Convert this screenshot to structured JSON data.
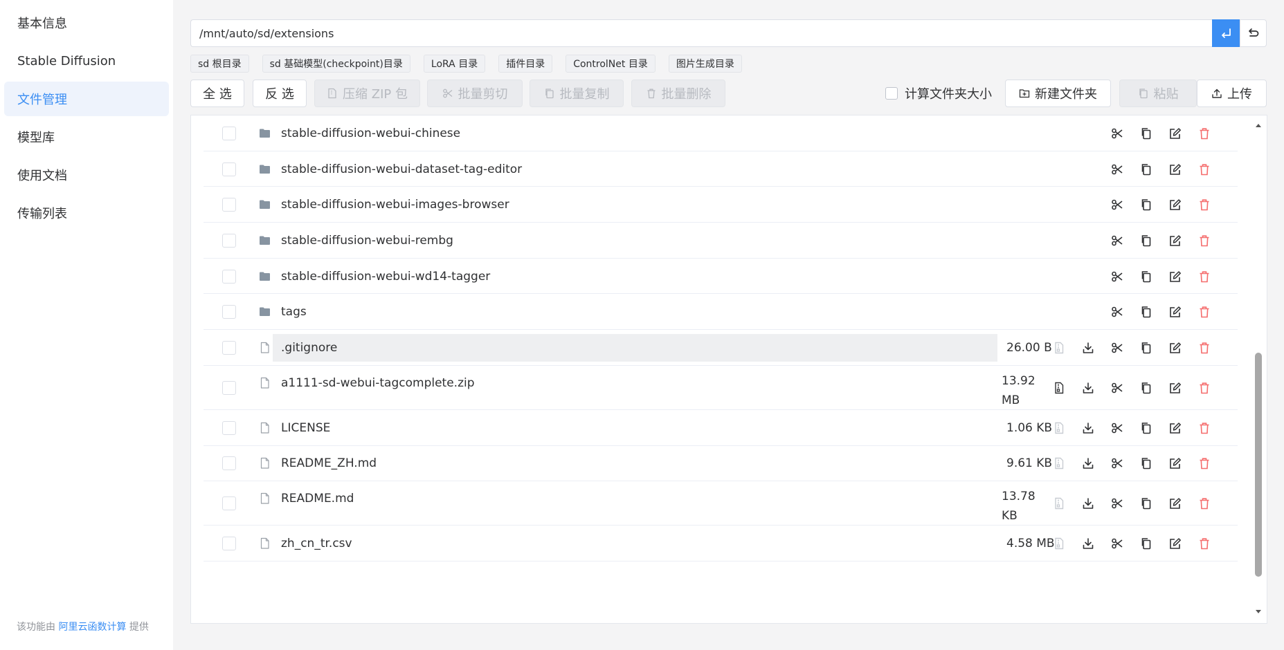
{
  "sidebar": {
    "items": [
      {
        "label": "基本信息",
        "active": false
      },
      {
        "label": "Stable Diffusion",
        "active": false
      },
      {
        "label": "文件管理",
        "active": true
      },
      {
        "label": "模型库",
        "active": false
      },
      {
        "label": "使用文档",
        "active": false
      },
      {
        "label": "传输列表",
        "active": false
      }
    ],
    "footer": {
      "prefix": "该功能由 ",
      "link": "阿里云函数计算",
      "suffix": " 提供"
    }
  },
  "path": {
    "value": "/mnt/auto/sd/extensions",
    "go_icon": "enter-icon",
    "back_icon": "return-icon"
  },
  "shortcuts": [
    "sd 根目录",
    "sd 基础模型(checkpoint)目录",
    "LoRA 目录",
    "插件目录",
    "ControlNet 目录",
    "图片生成目录"
  ],
  "toolbar": {
    "select_all": "全 选",
    "invert": "反 选",
    "zip": "压缩 ZIP 包",
    "batch_cut": "批量剪切",
    "batch_copy": "批量复制",
    "batch_delete": "批量删除",
    "calc_size": "计算文件夹大小",
    "new_folder": "新建文件夹",
    "paste": "粘贴",
    "upload": "上传"
  },
  "files": [
    {
      "name": "stable-diffusion-webui-chinese",
      "type": "folder",
      "size": ""
    },
    {
      "name": "stable-diffusion-webui-dataset-tag-editor",
      "type": "folder",
      "size": ""
    },
    {
      "name": "stable-diffusion-webui-images-browser",
      "type": "folder",
      "size": ""
    },
    {
      "name": "stable-diffusion-webui-rembg",
      "type": "folder",
      "size": ""
    },
    {
      "name": "stable-diffusion-webui-wd14-tagger",
      "type": "folder",
      "size": ""
    },
    {
      "name": "tags",
      "type": "folder",
      "size": ""
    },
    {
      "name": ".gitignore",
      "type": "file",
      "size": "26.00 B",
      "highlighted": true,
      "unzip_enabled": false
    },
    {
      "name": "a1111-sd-webui-tagcomplete.zip",
      "type": "file",
      "size": "13.92 MB",
      "size_line1": "13.92",
      "size_line2": "MB",
      "unzip_enabled": true
    },
    {
      "name": "LICENSE",
      "type": "file",
      "size": "1.06 KB",
      "unzip_enabled": false
    },
    {
      "name": "README_ZH.md",
      "type": "file",
      "size": "9.61 KB",
      "unzip_enabled": false
    },
    {
      "name": "README.md",
      "type": "file",
      "size": "13.78 KB",
      "size_line1": "13.78",
      "size_line2": "KB",
      "unzip_enabled": false
    },
    {
      "name": "zh_cn_tr.csv",
      "type": "file",
      "size": "4.58 MB",
      "unzip_enabled": false
    }
  ],
  "colors": {
    "accent": "#3b8ef3",
    "danger": "#f56c6c",
    "folder": "#8794a1"
  }
}
